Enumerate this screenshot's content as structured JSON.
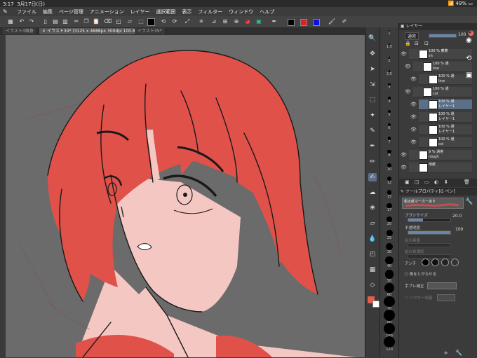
{
  "status": {
    "time": "3:17",
    "date": "3月17日(日)",
    "battery": "49%"
  },
  "menu": [
    "ファイル",
    "編集",
    "ページ管理",
    "アニメーション",
    "レイヤー",
    "選択範囲",
    "表示",
    "フィルター",
    "ウィンドウ",
    "ヘルプ"
  ],
  "tabs": [
    {
      "label": "イラスト3頭身"
    },
    {
      "label": "イラスト34* (3125 x 4688px 300dpi 100.8%)"
    },
    {
      "label": "イラスト35*"
    }
  ],
  "cmd_colors": [
    "#000000",
    "#e02020",
    "#1010e0"
  ],
  "brush_sizes": [
    "1",
    "1.5",
    "2",
    "2.5",
    "3",
    "4",
    "5",
    "6",
    "7",
    "8",
    "10",
    "12",
    "15",
    "17",
    "20",
    "25",
    "30",
    "40",
    "50",
    "60",
    "70",
    "80",
    "100",
    "120"
  ],
  "layer_panel": {
    "title": "レイヤー",
    "blend_mode": "通常",
    "opacity": "100",
    "layers": [
      {
        "line1": "100 % 乗算",
        "line2": "sh"
      },
      {
        "line1": "100 % 通",
        "line2": "line"
      },
      {
        "line1": "100 % 通",
        "line2": "line"
      },
      {
        "line1": "100 % 通",
        "line2": "col"
      },
      {
        "line1": "100 % 通",
        "line2": "レイヤー1"
      },
      {
        "line1": "100 % 通",
        "line2": "レイヤー1"
      },
      {
        "line1": "100 % 通",
        "line2": "レイヤー1"
      },
      {
        "line1": "100 % 通",
        "line2": "col"
      },
      {
        "line1": "9 % 通常",
        "line2": "rough"
      },
      {
        "line1": "",
        "line2": "用紙"
      }
    ]
  },
  "tool_property": {
    "title": "ツールプロパティ[G ペン]",
    "brush_name": "粗る紙マーカーあり",
    "brush_size_label": "ブラシサイズ",
    "brush_size_value": "20.0",
    "opacity_label": "不透明度",
    "opacity_value": "100",
    "color_mix_label": "絵の具量",
    "color_density_label": "絵の具濃度",
    "aa_label": "アンチ",
    "corner_label": "角をとがらせる",
    "stabilization_label": "手ブレ補正",
    "vector_label": "ベクター吸着"
  },
  "colors": {
    "main": "#e0604c",
    "sub": "#ffffff"
  }
}
